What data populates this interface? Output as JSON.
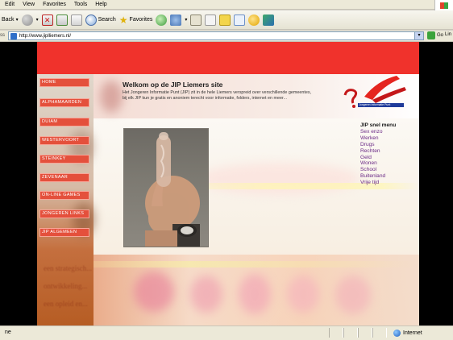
{
  "menubar": {
    "items": [
      "Edit",
      "View",
      "Favorites",
      "Tools",
      "Help"
    ]
  },
  "toolbar": {
    "back_label": "Back",
    "search_label": "Search",
    "favorites_label": "Favorites"
  },
  "address": {
    "url": "http://www.jiplliemers.nl/",
    "go_label": "Go",
    "links_label": "Lin"
  },
  "site": {
    "nav_items": [
      "HOME",
      "ALPHAMAARDEN",
      "DUIAM",
      "WESTERVOORT",
      "STEINKEY",
      "ZEVENAAR",
      "ON-LINE GAMES",
      "JONGEREN LINKS",
      "JIP ALGEMEEN"
    ],
    "heading": "Welkom op de JIP Liemers site",
    "intro": "Het Jongeren Informatie Punt (JIP) zit in de hele Liemers verspreid over verschillende gemeentes, bij elk JIP kun je gratis en anoniem terecht voor informatie, folders, internet en meer...",
    "logo_badge": "Jongeren Informatie Punt",
    "snel_menu": {
      "title": "JIP snel menu",
      "items": [
        "Sex enzo",
        "Werken",
        "Drugs",
        "Rechten",
        "Geld",
        "Wonen",
        "School",
        "Buitenland",
        "Vrije tijd"
      ]
    },
    "bg_texts": [
      "een strategisch...",
      "ontwikkeling...",
      "een opleid en..."
    ]
  },
  "status": {
    "left_text": "ne",
    "zone_label": "Internet"
  },
  "colors": {
    "brand_red": "#f0322c",
    "nav_red": "#e4503c",
    "snel_link": "#6b2a86"
  }
}
